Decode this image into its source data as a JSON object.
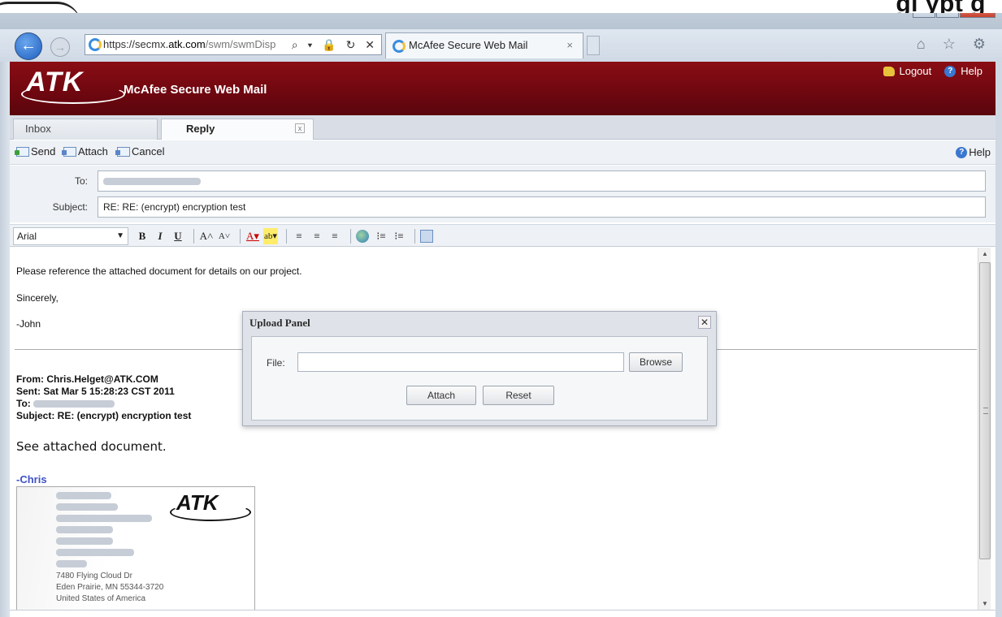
{
  "slide": {
    "title": "gi  ypt    g"
  },
  "browser": {
    "window_controls": {
      "minimize": "–",
      "maximize": "□",
      "close": "✕"
    },
    "back_glyph": "←",
    "forward_glyph": "→",
    "url_prefix": "https://secmx.",
    "url_domain": "atk.com",
    "url_rest": "/swm/swmDisp",
    "address_controls": "⌕ ▾ 🔒 ↻ ✕",
    "tab_title": "McAfee Secure Web Mail",
    "tab_close": "×",
    "toolbar_icons": "⌂ ☆ ⚙"
  },
  "app": {
    "logo": "ATK",
    "title": "McAfee Secure Web Mail",
    "logout_label": "Logout",
    "help_label": "Help",
    "help_glyph": "?"
  },
  "mail_tabs": [
    {
      "label": "Inbox"
    },
    {
      "label": "Reply",
      "close": "x"
    }
  ],
  "actions": {
    "send_label": "Send",
    "attach_label": "Attach",
    "cancel_label": "Cancel",
    "help_label": "Help"
  },
  "fields": {
    "to_label": "To:",
    "subject_label": "Subject:",
    "subject_value": "RE: RE: (encrypt) encryption test"
  },
  "format": {
    "font": "Arial",
    "font_arrow": "▼",
    "bold": "B",
    "italic": "I",
    "underline": "U",
    "grow": "A˄",
    "shrink": "A˅",
    "font_color": "A▾",
    "highlight": "ab▾",
    "align_left": "≡",
    "align_center": "≡",
    "align_right": "≡",
    "ordered_list": "⁝≡",
    "bullet_list": "⁝≡"
  },
  "body": {
    "line1": "Please reference the attached document for details on our project.",
    "line2": "Sincerely,",
    "line3": "-John",
    "from": "From: Chris.Helget@ATK.COM",
    "sent": "Sent: Sat Mar 5 15:28:23 CST 2011",
    "to_prefix": "To: ",
    "subject": "Subject: RE: (encrypt) encryption test",
    "see_attached": "See attached document.",
    "sig_name": "-Chris",
    "card": {
      "logo": "ATK",
      "street": "7480 Flying Cloud Dr",
      "city": "Eden Prairie, MN 55344-3720",
      "country": "United States of America"
    }
  },
  "scrollbar": {
    "up": "▲",
    "down": "▼"
  },
  "dialog": {
    "title": "Upload Panel",
    "close": "✕",
    "file_label": "File:",
    "browse_label": "Browse",
    "attach_label": "Attach",
    "reset_label": "Reset"
  }
}
